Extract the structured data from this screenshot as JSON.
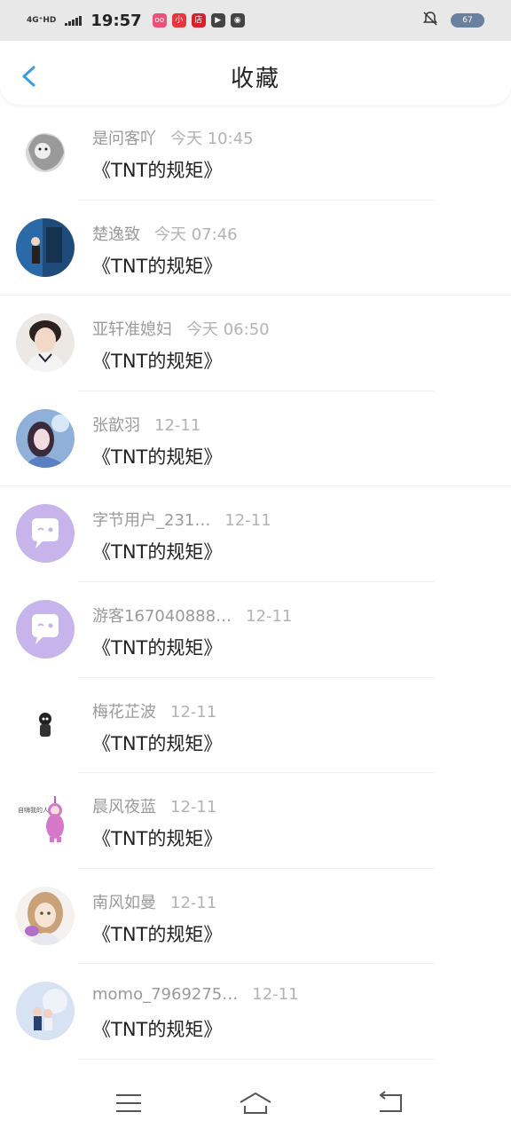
{
  "status": {
    "network": "4G⁺HD",
    "time": "19:57",
    "battery": "67",
    "apps": [
      {
        "name": "photo-app-icon",
        "color": "#f04f7a",
        "text": "oo"
      },
      {
        "name": "shop-app-icon",
        "color": "#e8373c",
        "text": "小"
      },
      {
        "name": "store-app-icon",
        "color": "#d81f2a",
        "text": "店"
      },
      {
        "name": "video-app-icon",
        "color": "#444444",
        "text": "▶"
      },
      {
        "name": "compass-app-icon",
        "color": "#444444",
        "text": "◉"
      }
    ]
  },
  "header": {
    "title": "收藏"
  },
  "items": [
    {
      "name": "是问客吖",
      "date": "今天 10:45",
      "content": "《TNT的规矩》",
      "avatar": "lion-sketch"
    },
    {
      "name": "楚逸致",
      "date": "今天 07:46",
      "content": "《TNT的规矩》",
      "avatar": "blue-photo"
    },
    {
      "name": "亚轩准媳妇",
      "date": "今天 06:50",
      "content": "《TNT的规矩》",
      "avatar": "boy-photo"
    },
    {
      "name": "张歆羽",
      "date": "12-11",
      "content": "《TNT的规矩》",
      "avatar": "girl-blue-photo"
    },
    {
      "name": "字节用户_231…",
      "date": "12-11",
      "content": "《TNT的规矩》",
      "avatar": "default-chat"
    },
    {
      "name": "游客167040888…",
      "date": "12-11",
      "content": "《TNT的规矩》",
      "avatar": "default-chat"
    },
    {
      "name": "梅花芷波",
      "date": "12-11",
      "content": "《TNT的规矩》",
      "avatar": "small-figure"
    },
    {
      "name": "晨风夜蓝",
      "date": "12-11",
      "content": "《TNT的规矩》",
      "avatar": "teletubby"
    },
    {
      "name": "南风如曼",
      "date": "12-11",
      "content": "《TNT的规矩》",
      "avatar": "anime-girl"
    },
    {
      "name": "momo_7969275…",
      "date": "12-11",
      "content": "《TNT的规矩》",
      "avatar": "couple-photo"
    }
  ],
  "colors": {
    "accent": "#3a9ee4",
    "default_avatar": "#c7b4ea"
  }
}
